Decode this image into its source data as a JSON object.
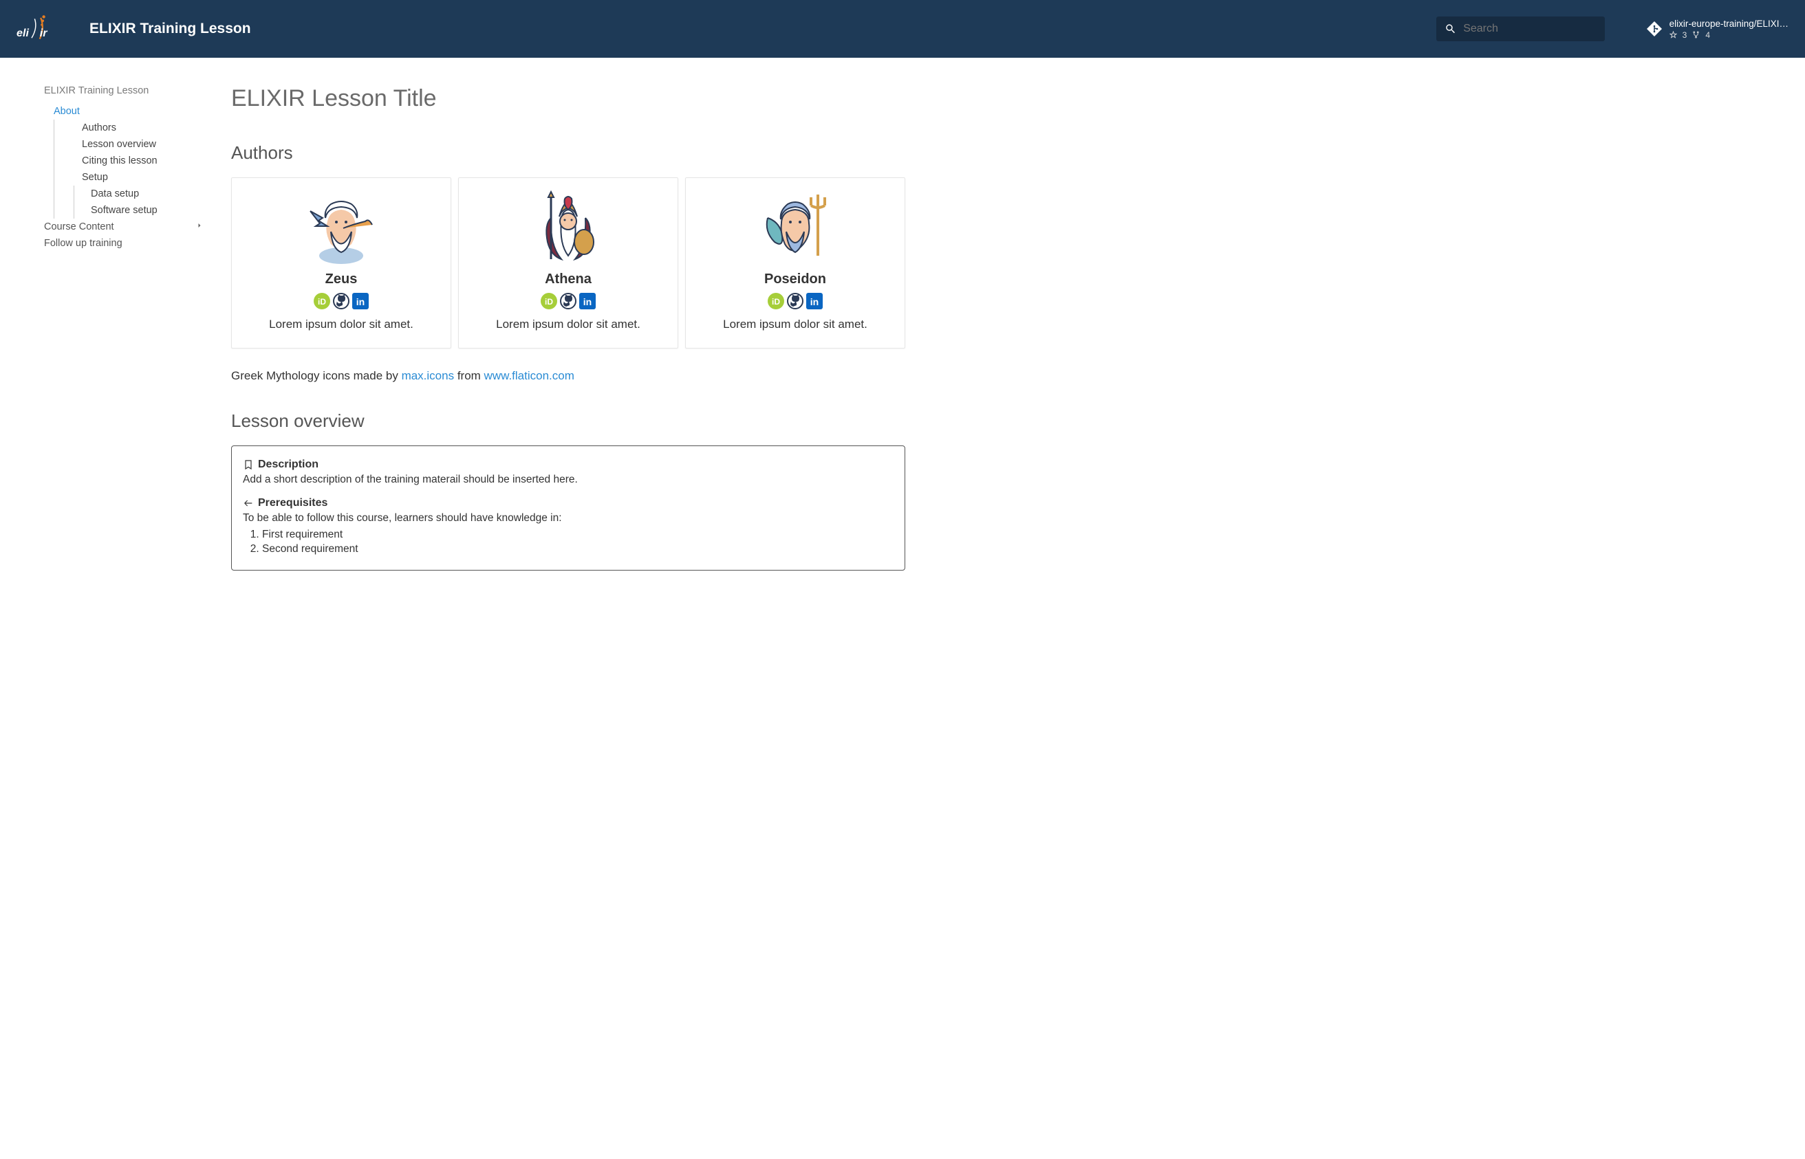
{
  "header": {
    "site_title": "ELIXIR Training Lesson",
    "search_placeholder": "Search",
    "repo_name": "elixir-europe-training/ELIXI…",
    "stars": "3",
    "forks": "4"
  },
  "sidebar": {
    "title": "ELIXIR Training Lesson",
    "items": [
      {
        "label": "About",
        "active": true,
        "children": [
          {
            "label": "Authors"
          },
          {
            "label": "Lesson overview"
          },
          {
            "label": "Citing this lesson"
          },
          {
            "label": "Setup",
            "children": [
              {
                "label": "Data setup"
              },
              {
                "label": "Software setup"
              }
            ]
          }
        ]
      },
      {
        "label": "Course Content",
        "expandable": true
      },
      {
        "label": "Follow up training"
      }
    ]
  },
  "main": {
    "title": "ELIXIR Lesson Title",
    "authors_heading": "Authors",
    "authors": [
      {
        "name": "Zeus",
        "desc": "Lorem ipsum dolor sit amet."
      },
      {
        "name": "Athena",
        "desc": "Lorem ipsum dolor sit amet."
      },
      {
        "name": "Poseidon",
        "desc": "Lorem ipsum dolor sit amet."
      }
    ],
    "attribution": {
      "prefix": "Greek Mythology icons made by ",
      "link1": "max.icons",
      "mid": " from ",
      "link2": "www.flaticon.com"
    },
    "lesson_overview_heading": "Lesson overview",
    "overview": {
      "desc_title": "Description",
      "desc_text": "Add a short description of the training materail should be inserted here.",
      "prereq_title": "Prerequisites",
      "prereq_intro": "To be able to follow this course, learners should have knowledge in:",
      "prereq_items": [
        "First requirement",
        "Second requirement"
      ]
    }
  }
}
